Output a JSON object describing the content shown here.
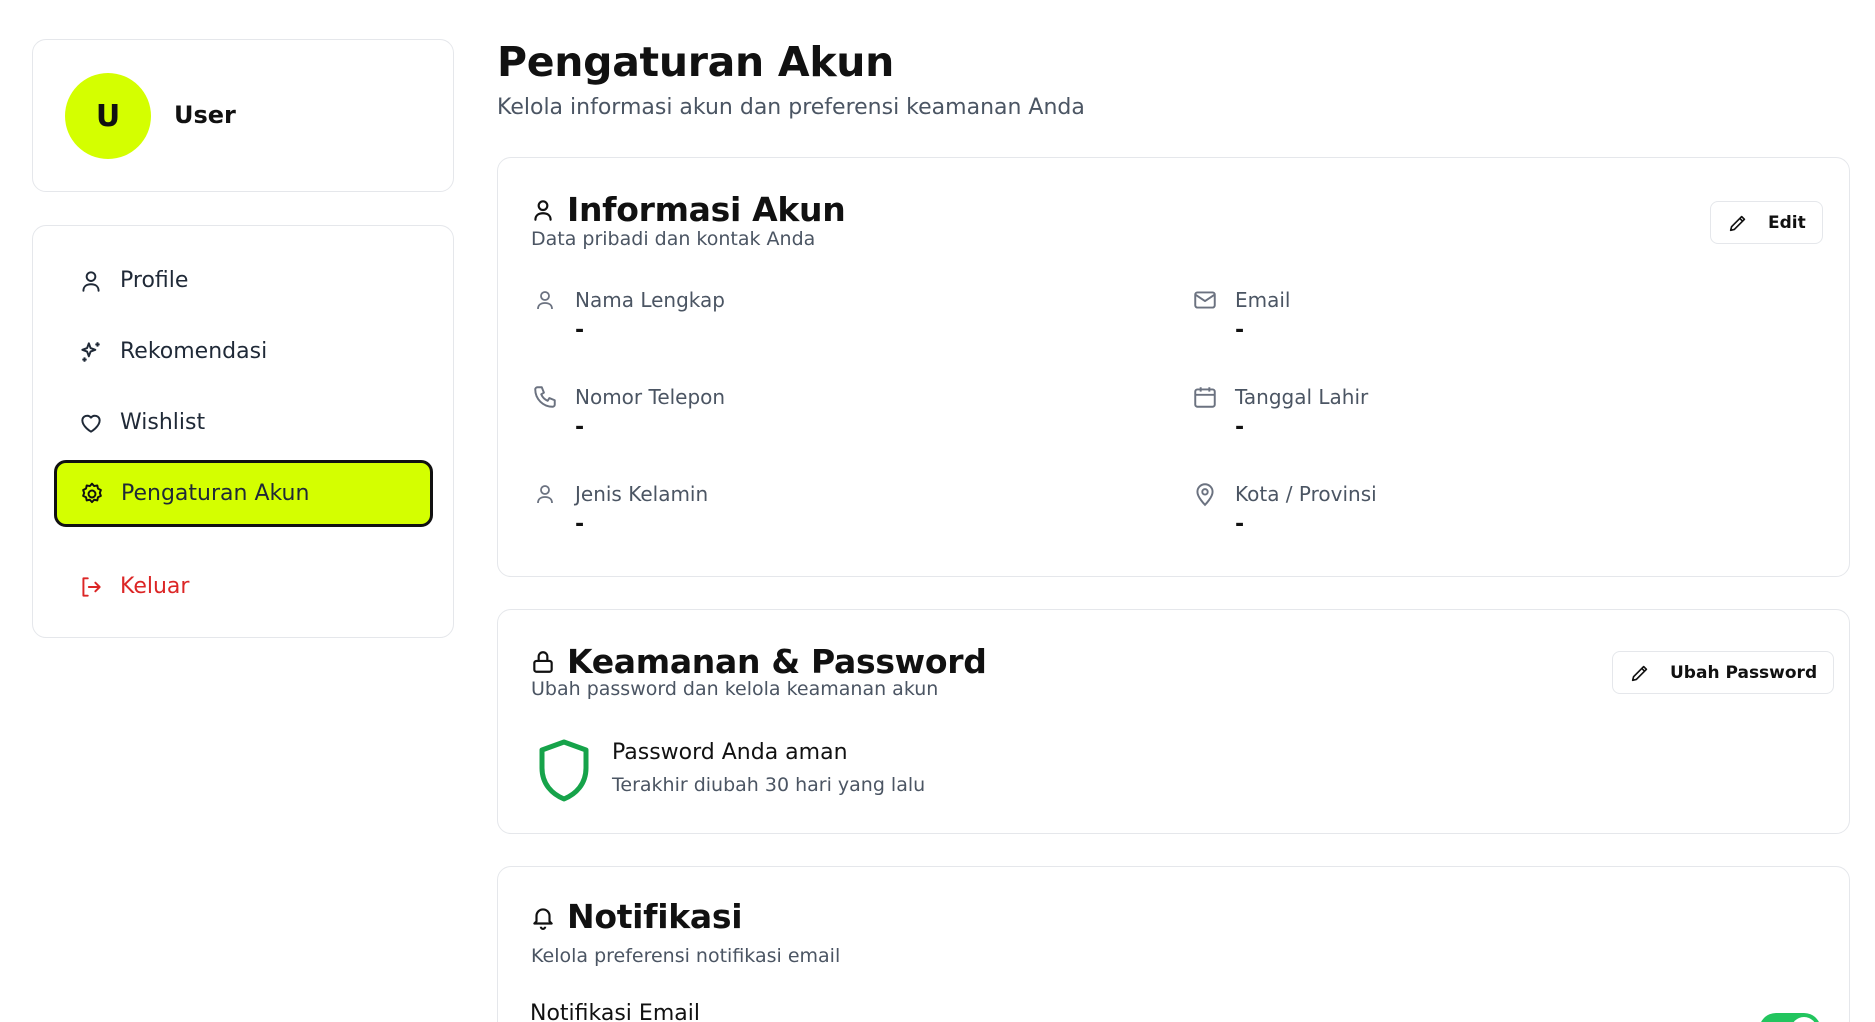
{
  "user": {
    "initial": "U",
    "name": "User"
  },
  "sidebar": {
    "items": [
      {
        "label": "Profile",
        "icon": "user-icon"
      },
      {
        "label": "Rekomendasi",
        "icon": "sparkles-icon"
      },
      {
        "label": "Wishlist",
        "icon": "heart-icon"
      },
      {
        "label": "Pengaturan Akun",
        "icon": "settings-icon",
        "active": true
      },
      {
        "label": "Keluar",
        "icon": "logout-icon"
      }
    ]
  },
  "page": {
    "title": "Pengaturan Akun",
    "subtitle": "Kelola informasi akun dan preferensi keamanan Anda"
  },
  "account": {
    "title": "Informasi Akun",
    "description": "Data pribadi dan kontak Anda",
    "edit_label": "Edit",
    "fields": [
      {
        "label": "Nama Lengkap",
        "value": "-",
        "icon": "user-icon"
      },
      {
        "label": "Email",
        "value": "-",
        "icon": "mail-icon"
      },
      {
        "label": "Nomor Telepon",
        "value": "-",
        "icon": "phone-icon"
      },
      {
        "label": "Tanggal Lahir",
        "value": "-",
        "icon": "calendar-icon"
      },
      {
        "label": "Jenis Kelamin",
        "value": "-",
        "icon": "user-icon"
      },
      {
        "label": "Kota / Provinsi",
        "value": "-",
        "icon": "map-pin-icon"
      }
    ]
  },
  "security": {
    "title": "Keamanan & Password",
    "description": "Ubah password dan kelola keamanan akun",
    "button_label": "Ubah Password",
    "status": "Password Anda aman",
    "status_sub": "Terakhir diubah 30 hari yang lalu"
  },
  "notifications": {
    "title": "Notifikasi",
    "description": "Kelola preferensi notifikasi email",
    "email_label": "Notifikasi Email",
    "email_enabled": true
  },
  "colors": {
    "accent": "#d4ff00",
    "danger": "#dc2626",
    "success": "#16a34a"
  }
}
